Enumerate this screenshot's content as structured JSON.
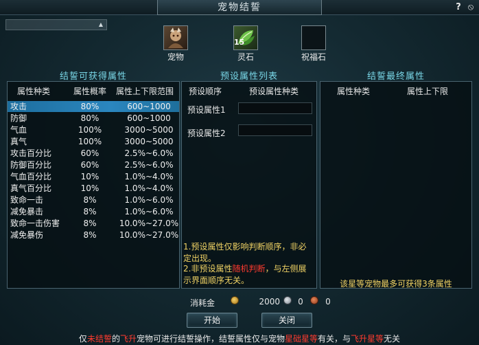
{
  "window": {
    "title": "宠物结誓",
    "help_glyph": "?",
    "close_glyph": "⦸"
  },
  "slots": {
    "pet_label": "宠物",
    "stone_label": "灵石",
    "stone_count": "15",
    "bless_label": "祝福石"
  },
  "sections": {
    "obtainable_title": "结誓可获得属性",
    "preset_title": "预设属性列表",
    "final_title": "结誓最终属性"
  },
  "obtainable": {
    "headers": {
      "type": "属性种类",
      "prob": "属性概率",
      "range": "属性上下限范围"
    },
    "rows": [
      {
        "name": "攻击",
        "prob": "80%",
        "range": "600~1000"
      },
      {
        "name": "防御",
        "prob": "80%",
        "range": "600~1000"
      },
      {
        "name": "气血",
        "prob": "100%",
        "range": "3000~5000"
      },
      {
        "name": "真气",
        "prob": "100%",
        "range": "3000~5000"
      },
      {
        "name": "攻击百分比",
        "prob": "60%",
        "range": "2.5%~6.0%"
      },
      {
        "name": "防御百分比",
        "prob": "60%",
        "range": "2.5%~6.0%"
      },
      {
        "name": "气血百分比",
        "prob": "10%",
        "range": "1.0%~4.0%"
      },
      {
        "name": "真气百分比",
        "prob": "10%",
        "range": "1.0%~4.0%"
      },
      {
        "name": "致命一击",
        "prob": "8%",
        "range": "1.0%~6.0%"
      },
      {
        "name": "减免暴击",
        "prob": "8%",
        "range": "1.0%~6.0%"
      },
      {
        "name": "致命一击伤害",
        "prob": "8%",
        "range": "10.0%~27.0%"
      },
      {
        "name": "减免暴伤",
        "prob": "8%",
        "range": "10.0%~27.0%"
      }
    ]
  },
  "preset": {
    "headers": {
      "order": "预设顺序",
      "type": "预设属性种类"
    },
    "items": [
      {
        "label": "预设属性1"
      },
      {
        "label": "预设属性2"
      }
    ],
    "note1": "1.预设属性仅影响判断顺序，非必定出现。",
    "note2_pre": "2.非预设属性",
    "note2_red": "随机判断",
    "note2_post": "，与左侧展示界面顺序无关。"
  },
  "final": {
    "headers": {
      "type": "属性种类",
      "range": "属性上下限"
    },
    "footer": "该星等宠物最多可获得3条属性"
  },
  "cost": {
    "label": "消耗金",
    "gold": "2000",
    "silver": "0",
    "copper": "0"
  },
  "buttons": {
    "start": "开始",
    "close": "关闭"
  },
  "bottom_note": {
    "p1": "仅",
    "r1": "未结誓",
    "p2": "的",
    "r2": "飞升",
    "p3": "宠物可进行结誓操作，结誓属性仅与宠物",
    "r3": "星础星等",
    "p4": "有关，与",
    "r4": "飞升星等",
    "p5": "无关"
  },
  "colors": {
    "accent_title": "#79d6e6",
    "note_yellow": "#f0d264",
    "warn_red": "#ff3b2f",
    "selected_row": "#2b86bf"
  }
}
